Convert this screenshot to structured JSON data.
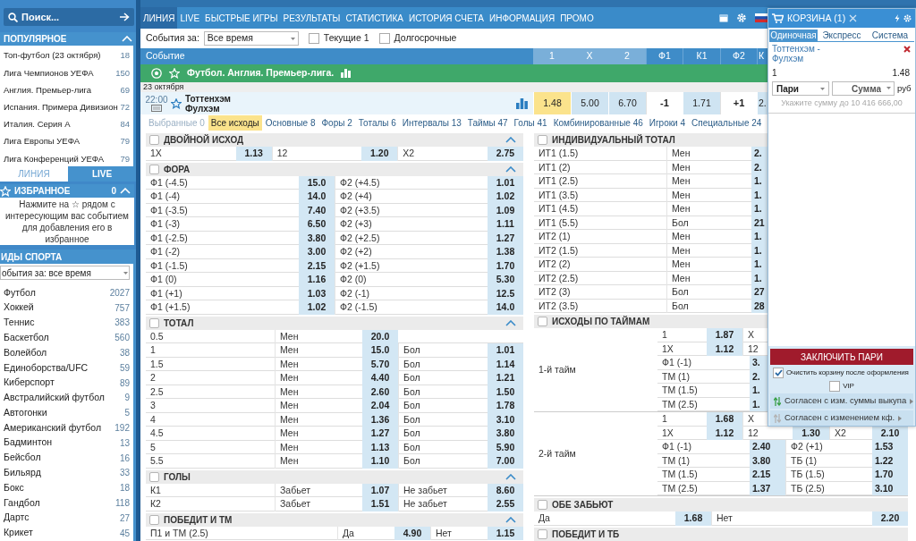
{
  "sidebar": {
    "search": {
      "placeholder": "Поиск..."
    },
    "popular": {
      "title": "ПОПУЛЯРНОЕ",
      "expanded": true,
      "items": [
        {
          "label": "Топ-футбол (23 октября)",
          "count": "18"
        },
        {
          "label": "Лига Чемпионов УЕФА",
          "count": "150"
        },
        {
          "label": "Англия. Премьер-лига",
          "count": "69"
        },
        {
          "label": "Испания. Примера Дивизион",
          "count": "72"
        },
        {
          "label": "Италия. Серия А",
          "count": "84"
        },
        {
          "label": "Лига Европы УЕФА",
          "count": "79"
        },
        {
          "label": "Лига Конференций УЕФА",
          "count": "79"
        }
      ]
    },
    "mode_tabs": [
      {
        "label": "ЛИНИЯ",
        "selected": true
      },
      {
        "label": "LIVE",
        "selected": false
      }
    ],
    "favorites": {
      "title": "ИЗБРАННОЕ",
      "count": "0",
      "expanded": true,
      "hint": "Нажмите на ☆ рядом с интересующим вас событием для добавления его в избранное"
    },
    "sports": {
      "title": "ИДЫ СПОРТА",
      "filter": "обытия за: все время",
      "items": [
        {
          "label": "Футбол",
          "count": "2027"
        },
        {
          "label": "Хоккей",
          "count": "757"
        },
        {
          "label": "Теннис",
          "count": "383"
        },
        {
          "label": "Баскетбол",
          "count": "560"
        },
        {
          "label": "Волейбол",
          "count": "38"
        },
        {
          "label": "Единоборства/UFC",
          "count": "59"
        },
        {
          "label": "Киберспорт",
          "count": "89"
        },
        {
          "label": "Австралийский футбол",
          "count": "9"
        },
        {
          "label": "Автогонки",
          "count": "5"
        },
        {
          "label": "Американский футбол",
          "count": "192"
        },
        {
          "label": "Бадминтон",
          "count": "13"
        },
        {
          "label": "Бейсбол",
          "count": "16"
        },
        {
          "label": "Бильярд",
          "count": "33"
        },
        {
          "label": "Бокс",
          "count": "18"
        },
        {
          "label": "Гандбол",
          "count": "118"
        },
        {
          "label": "Дартс",
          "count": "27"
        },
        {
          "label": "Крикет",
          "count": "45"
        }
      ]
    }
  },
  "nav": {
    "items": [
      {
        "label": "ЛИНИЯ",
        "selected": true
      },
      {
        "label": "LIVE",
        "selected": false
      },
      {
        "label": "БЫСТРЫЕ ИГРЫ",
        "selected": false
      },
      {
        "label": "РЕЗУЛЬТАТЫ",
        "selected": false
      },
      {
        "label": "СТАТИСТИКА",
        "selected": false
      },
      {
        "label": "ИСТОРИЯ СЧЕТА",
        "selected": false
      },
      {
        "label": "ИНФОРМАЦИЯ",
        "selected": false
      },
      {
        "label": "ПРОМО",
        "selected": false
      }
    ]
  },
  "filter": {
    "label": "События за:",
    "period": "Все время",
    "checkboxes": [
      {
        "label": "Текущие 1",
        "checked": false
      },
      {
        "label": "Долгосрочные",
        "checked": false
      }
    ]
  },
  "table_header": {
    "columns": [
      {
        "label": "Событие",
        "kind": "event"
      },
      {
        "label": "1",
        "kind": "main"
      },
      {
        "label": "X",
        "kind": "main"
      },
      {
        "label": "2",
        "kind": "main"
      },
      {
        "label": "Ф1",
        "kind": "extra"
      },
      {
        "label": "К1",
        "kind": "extra"
      },
      {
        "label": "Ф2",
        "kind": "extra"
      },
      {
        "label": "К",
        "kind": "extra"
      }
    ]
  },
  "event": {
    "league": "Футбол. Англия. Премьер-лига.",
    "date": "23 октября",
    "time": "22:00",
    "home": "Тоттенхэм",
    "away": "Фулхэм",
    "cells": [
      {
        "text": "1.48",
        "kind": "odd",
        "selected": true
      },
      {
        "text": "5.00",
        "kind": "odd",
        "selected": false
      },
      {
        "text": "6.70",
        "kind": "odd",
        "selected": false
      },
      {
        "text": "-1",
        "kind": "handicap"
      },
      {
        "text": "1.71",
        "kind": "odd",
        "selected": false
      },
      {
        "text": "+1",
        "kind": "handicap"
      },
      {
        "text": "2.",
        "kind": "odd",
        "selected": false
      }
    ]
  },
  "market_tabs": [
    {
      "label": "Выбранные 0",
      "selected": false,
      "disabled": true
    },
    {
      "label": "Все исходы",
      "selected": true,
      "disabled": false
    },
    {
      "label": "Основные 8",
      "selected": false,
      "disabled": false
    },
    {
      "label": "Форы 2",
      "selected": false,
      "disabled": false
    },
    {
      "label": "Тоталы 6",
      "selected": false,
      "disabled": false
    },
    {
      "label": "Интервалы 13",
      "selected": false,
      "disabled": false
    },
    {
      "label": "Таймы 47",
      "selected": false,
      "disabled": false
    },
    {
      "label": "Голы 41",
      "selected": false,
      "disabled": false
    },
    {
      "label": "Комбинированные 46",
      "selected": false,
      "disabled": false
    },
    {
      "label": "Игроки 4",
      "selected": false,
      "disabled": false
    },
    {
      "label": "Специальные 24",
      "selected": false,
      "disabled": false
    }
  ],
  "markets_left": [
    {
      "title": "ДВОЙНОЙ ИСХОД",
      "checked": false,
      "expanded": true,
      "kind": "triple",
      "rows": [
        [
          "1X",
          "1.13",
          "12",
          "1.20",
          "X2",
          "2.75"
        ]
      ]
    },
    {
      "title": "ФОРА",
      "checked": false,
      "expanded": true,
      "kind": "pairs",
      "rows": [
        [
          "Ф1 (-4.5)",
          "15.0",
          "Ф2 (+4.5)",
          "1.01"
        ],
        [
          "Ф1 (-4)",
          "14.0",
          "Ф2 (+4)",
          "1.02"
        ],
        [
          "Ф1 (-3.5)",
          "7.40",
          "Ф2 (+3.5)",
          "1.09"
        ],
        [
          "Ф1 (-3)",
          "6.50",
          "Ф2 (+3)",
          "1.11"
        ],
        [
          "Ф1 (-2.5)",
          "3.80",
          "Ф2 (+2.5)",
          "1.27"
        ],
        [
          "Ф1 (-2)",
          "3.00",
          "Ф2 (+2)",
          "1.38"
        ],
        [
          "Ф1 (-1.5)",
          "2.15",
          "Ф2 (+1.5)",
          "1.70"
        ],
        [
          "Ф1 (0)",
          "1.16",
          "Ф2 (0)",
          "5.30"
        ],
        [
          "Ф1 (+1)",
          "1.03",
          "Ф2 (-1)",
          "12.5"
        ],
        [
          "Ф1 (+1.5)",
          "1.02",
          "Ф2 (-1.5)",
          "14.0"
        ]
      ]
    },
    {
      "title": "ТОТАЛ",
      "checked": false,
      "expanded": true,
      "kind": "total",
      "rows": [
        [
          "0.5",
          "Мен",
          "20.0"
        ],
        [
          "1",
          "Мен",
          "15.0",
          "Бол",
          "1.01"
        ],
        [
          "1.5",
          "Мен",
          "5.70",
          "Бол",
          "1.14"
        ],
        [
          "2",
          "Мен",
          "4.40",
          "Бол",
          "1.21"
        ],
        [
          "2.5",
          "Мен",
          "2.60",
          "Бол",
          "1.50"
        ],
        [
          "3",
          "Мен",
          "2.04",
          "Бол",
          "1.78"
        ],
        [
          "4",
          "Мен",
          "1.36",
          "Бол",
          "3.10"
        ],
        [
          "4.5",
          "Мен",
          "1.27",
          "Бол",
          "3.80"
        ],
        [
          "5",
          "Мен",
          "1.13",
          "Бол",
          "5.90"
        ],
        [
          "5.5",
          "Мен",
          "1.10",
          "Бол",
          "7.00"
        ]
      ]
    },
    {
      "title": "ГОЛЫ",
      "checked": false,
      "expanded": true,
      "kind": "total",
      "rows": [
        [
          "К1",
          "Забьет",
          "1.07",
          "Не забьет",
          "8.60"
        ],
        [
          "К2",
          "Забьет",
          "1.51",
          "Не забьет",
          "2.55"
        ]
      ]
    },
    {
      "title": "ПОБЕДИТ И ТМ",
      "checked": false,
      "expanded": true,
      "kind": "yesno",
      "rows": [
        [
          "П1 и ТМ (2.5)",
          "Да",
          "4.90",
          "Нет",
          "1.15"
        ]
      ]
    }
  ],
  "markets_right": [
    {
      "title": "ИНДИВИДУАЛЬНЫЙ ТОТАЛ",
      "checked": false,
      "kind": "individual",
      "rows": [
        [
          "ИТ1 (1.5)",
          "Мен",
          "2."
        ],
        [
          "ИТ1 (2)",
          "Мен",
          "2."
        ],
        [
          "ИТ1 (2.5)",
          "Мен",
          "1."
        ],
        [
          "ИТ1 (3.5)",
          "Мен",
          "1."
        ],
        [
          "ИТ1 (4.5)",
          "Мен",
          "1."
        ],
        [
          "ИТ1 (5.5)",
          "Бол",
          "21"
        ],
        [
          "ИТ2 (1)",
          "Мен",
          "1."
        ],
        [
          "ИТ2 (1.5)",
          "Мен",
          "1."
        ],
        [
          "ИТ2 (2)",
          "Мен",
          "1."
        ],
        [
          "ИТ2 (2.5)",
          "Мен",
          "1."
        ],
        [
          "ИТ2 (3)",
          "Бол",
          "27"
        ],
        [
          "ИТ2 (3.5)",
          "Бол",
          "28"
        ]
      ]
    },
    {
      "title": "ИСХОДЫ ПО ТАЙМАМ",
      "checked": false,
      "kind": "halves",
      "halves": [
        {
          "label": "1-й тайм",
          "outcomes": [
            [
              "1",
              "1.87",
              "X"
            ],
            [
              "1X",
              "1.12",
              "12"
            ]
          ],
          "lines": [
            [
              "Ф1 (-1)",
              "3."
            ],
            [
              "ТМ (1)",
              "2."
            ],
            [
              "ТМ (1.5)",
              "1."
            ],
            [
              "ТМ (2.5)",
              "1."
            ]
          ]
        },
        {
          "label": "2-й тайм",
          "outcomes": [
            [
              "1",
              "1.68",
              "X"
            ],
            [
              "1X",
              "1.12",
              "12",
              "1.30",
              "X2",
              "2.10"
            ]
          ],
          "lines": [
            [
              "Ф1 (-1)",
              "2.40",
              "Ф2 (+1)",
              "1.53"
            ],
            [
              "ТМ (1)",
              "3.80",
              "ТБ (1)",
              "1.22"
            ],
            [
              "ТМ (1.5)",
              "2.15",
              "ТБ (1.5)",
              "1.70"
            ],
            [
              "ТМ (2.5)",
              "1.37",
              "ТБ (2.5)",
              "3.10"
            ]
          ]
        }
      ]
    },
    {
      "title": "ОБЕ ЗАБЬЮТ",
      "checked": false,
      "kind": "both",
      "rows": [
        [
          "Да",
          "1.68",
          "Нет",
          "2.20"
        ]
      ]
    },
    {
      "title": "ПОБЕДИТ И ТБ",
      "checked": false,
      "kind": "both"
    }
  ],
  "basket": {
    "title": "КОРЗИНА (1)",
    "tabs": [
      {
        "label": "Одиночная",
        "selected": true
      },
      {
        "label": "Экспресс",
        "selected": false
      },
      {
        "label": "Система",
        "selected": false
      }
    ],
    "bet": {
      "event": "Тоттенхэм - Фулхэм",
      "outcome": "1",
      "odd": "1.48"
    },
    "bet_type": "Пари",
    "amount": {
      "placeholder": "Сумма"
    },
    "currency": "руб",
    "hint": "Укажите сумму до 10 416 666,00",
    "submit": "ЗАКЛЮЧИТЬ ПАРИ",
    "options": [
      {
        "label": "Очистить корзину после оформления",
        "checked": true
      },
      {
        "label": "VIP",
        "checked": false
      }
    ],
    "agreements": [
      {
        "label": "Согласен с изм. суммы выкупа",
        "on": true
      },
      {
        "label": "Согласен с изменением кф.",
        "on": false
      }
    ]
  }
}
